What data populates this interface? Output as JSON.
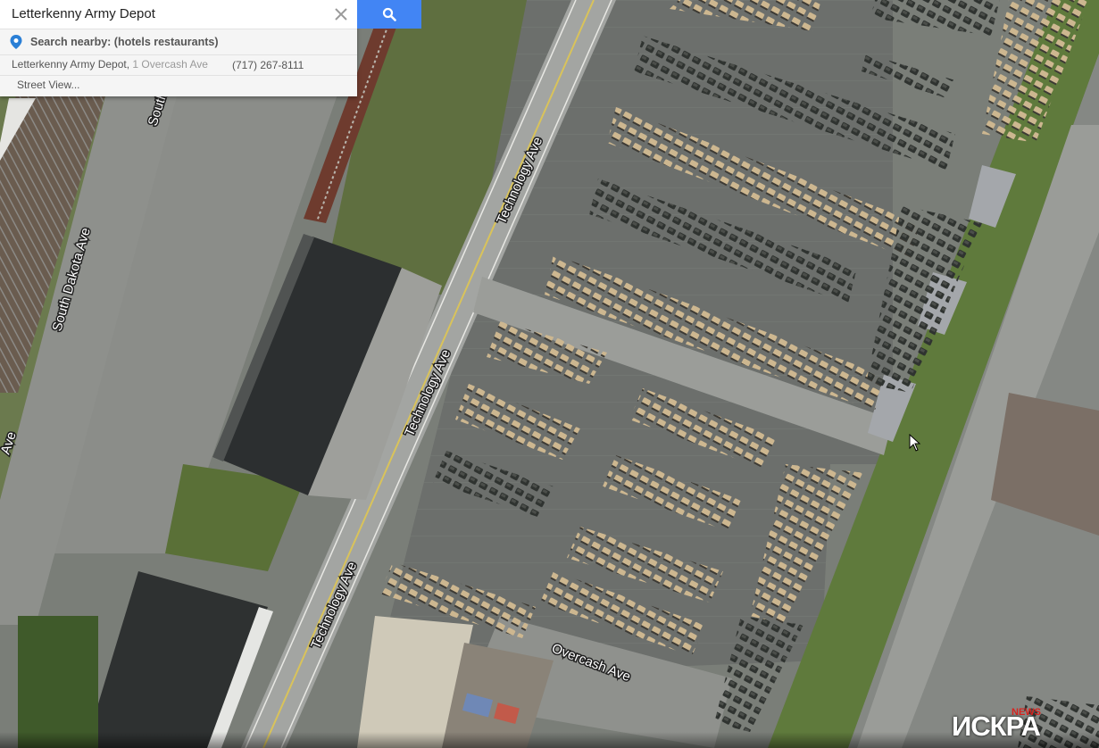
{
  "search": {
    "query": "Letterkenny Army Depot",
    "nearby_text": "Search nearby: (hotels restaurants)",
    "result_name": "Letterkenny Army Depot,",
    "result_address": " 1 Overcash Ave",
    "result_phone": "(717) 267-8111",
    "street_view": "Street View..."
  },
  "map": {
    "roads": {
      "technology_ave_1": "Technology Ave",
      "technology_ave_2": "Technology Ave",
      "technology_ave_3": "Technology Ave",
      "south_dakota_ave": "South Dakota Ave",
      "overcash_ave": "Overcash Ave",
      "south_partial": "South D",
      "ave_partial": "Ave"
    }
  },
  "branding": {
    "news": "NEWS",
    "name": "ИСКРА"
  },
  "colors": {
    "search_button": "#4285f4",
    "pin": "#2a7fd6",
    "brand_red": "#d8231f"
  },
  "icons": {
    "clear": "close-icon",
    "search": "magnifier-icon",
    "pin": "location-pin-icon",
    "cursor": "mouse-cursor-icon"
  }
}
